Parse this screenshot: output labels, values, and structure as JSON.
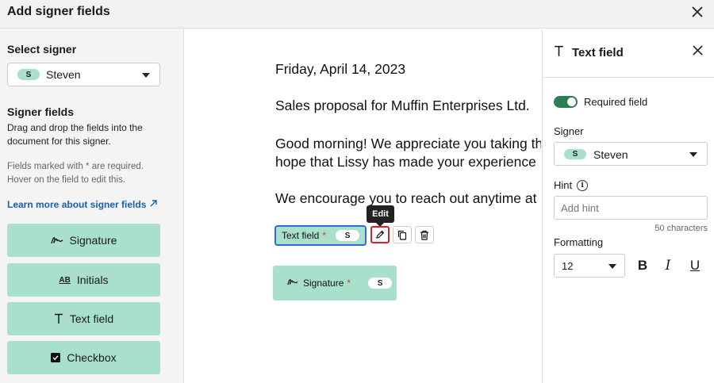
{
  "header": {
    "title": "Add signer fields",
    "close_icon": "close-icon"
  },
  "left": {
    "select_signer_label": "Select signer",
    "signer": {
      "initial": "S",
      "name": "Steven"
    },
    "signer_fields_title": "Signer fields",
    "drag_desc": "Drag and drop the fields into the document for this signer.",
    "required_desc": "Fields marked with * are required. Hover on the field to edit this.",
    "learn_more": "Learn more about signer fields",
    "fields": [
      {
        "label": "Signature",
        "icon": "signature-icon"
      },
      {
        "label": "Initials",
        "icon": "initials-icon",
        "icon_text": "AB"
      },
      {
        "label": "Text field",
        "icon": "text-icon"
      },
      {
        "label": "Checkbox",
        "icon": "checkbox-icon"
      }
    ]
  },
  "document": {
    "lines": [
      "Friday, April 14, 2023",
      "Sales proposal for Muffin Enterprises Ltd.",
      "Good morning! We appreciate you taking th",
      "hope that Lissy has made your experience",
      "We encourage you to reach out anytime at"
    ],
    "text_field": {
      "label": "Text field",
      "required_mark": "*",
      "initial": "S"
    },
    "signature_field": {
      "label": "Signature",
      "required_mark": "*",
      "initial": "S"
    },
    "tooltip": "Edit"
  },
  "panel": {
    "title": "Text field",
    "required_label": "Required field",
    "signer_label": "Signer",
    "signer": {
      "initial": "S",
      "name": "Steven"
    },
    "hint_label": "Hint",
    "hint_placeholder": "Add hint",
    "char_limit": "50 characters",
    "formatting_label": "Formatting",
    "font_size": "12",
    "bold": "B",
    "italic": "I",
    "underline": "U"
  },
  "colors": {
    "field_green": "#a8e0cc",
    "toggle_green": "#2e7d4f",
    "link_blue": "#1a5fb4",
    "edit_red": "#e01b24"
  }
}
